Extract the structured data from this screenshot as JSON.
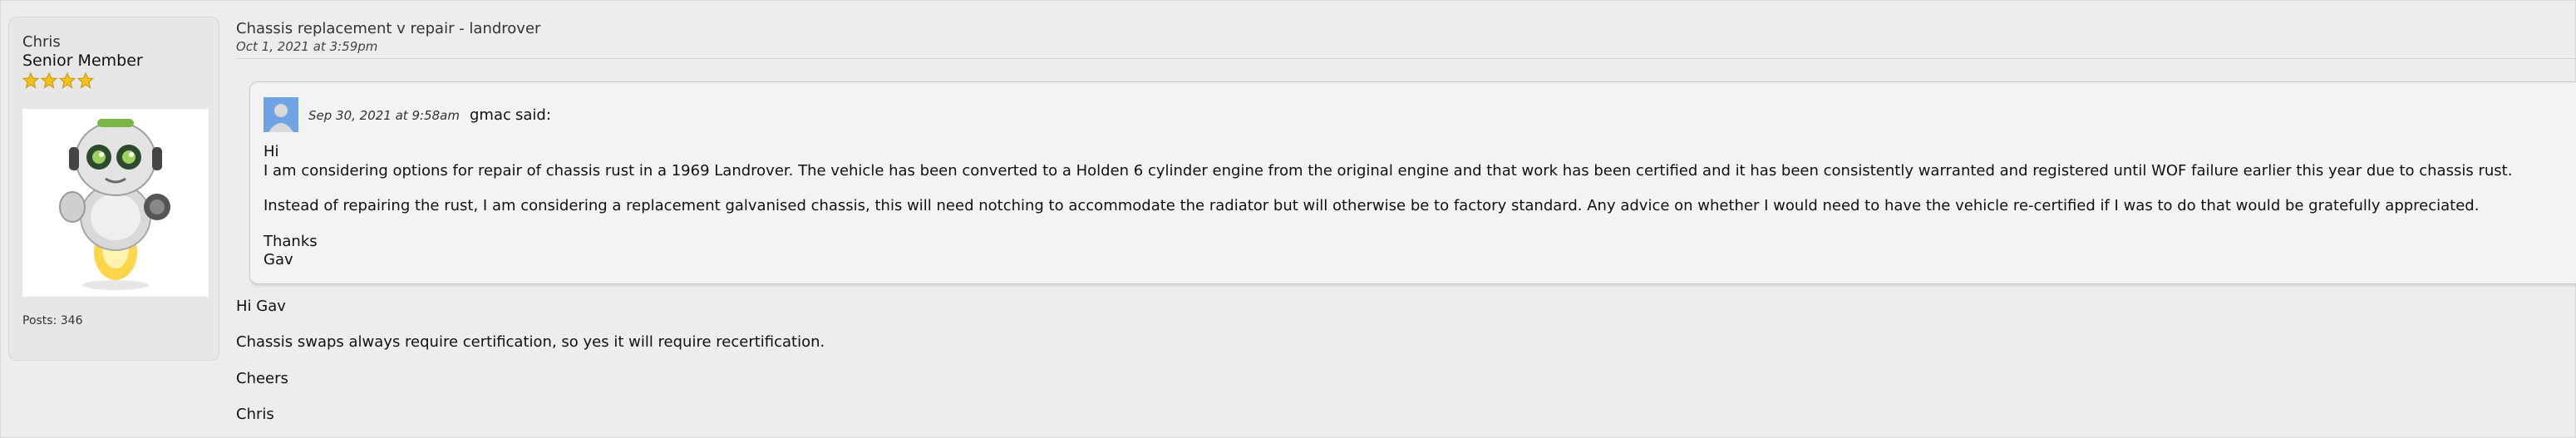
{
  "author": {
    "name": "Chris",
    "rank": "Senior Member",
    "stars": 4,
    "posts": "Posts: 346"
  },
  "post": {
    "title": "Chassis replacement v repair - landrover",
    "date": "Oct 1, 2021 at 3:59pm"
  },
  "quote": {
    "date": "Sep 30, 2021 at 9:58am",
    "user": "gmac",
    "said": "said:",
    "lines": [
      "Hi",
      "I am considering options for repair of chassis rust in a 1969 Landrover. The vehicle has been converted to a Holden 6 cylinder engine from the original engine and that work has been certified and it has been consistently warranted and registered until WOF failure earlier this year due to chassis rust.",
      "Instead of repairing the rust, I am considering a replacement galvanised chassis, this will need notching to accommodate the radiator but will otherwise be to factory standard. Any advice on whether I would need to have the vehicle re-certified if I was to do that would be gratefully appreciated.",
      "Thanks",
      "Gav"
    ]
  },
  "reply": {
    "lines": [
      "Hi Gav",
      "Chassis swaps always require certification, so yes it will require recertification.",
      "Cheers",
      "Chris"
    ]
  },
  "colors": {
    "star": "#f2c21b",
    "quote_border": "#c9c9c9",
    "quote_avatar": "#6fa3e3"
  }
}
